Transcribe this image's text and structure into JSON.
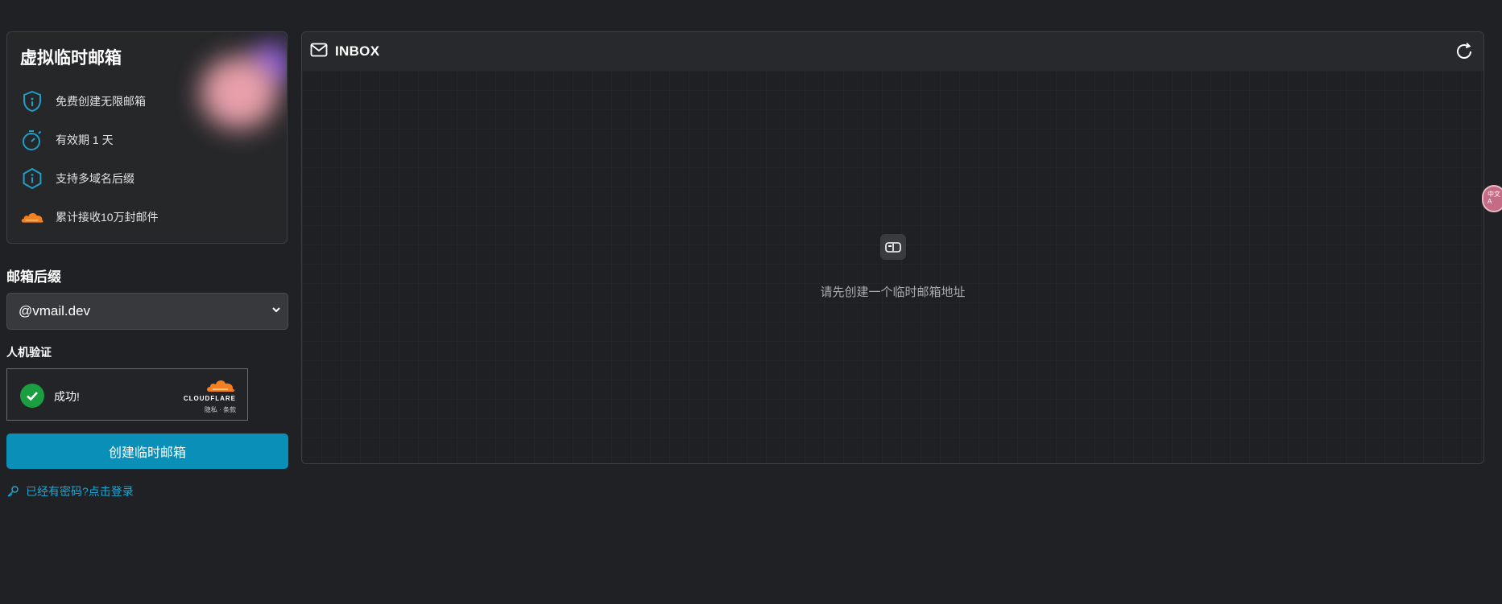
{
  "info_card": {
    "title": "虚拟临时邮箱",
    "features": [
      {
        "icon": "shield-icon",
        "text": "免费创建无限邮箱"
      },
      {
        "icon": "stopwatch-icon",
        "text": "有效期 1 天"
      },
      {
        "icon": "info-icon",
        "text": "支持多域名后缀"
      },
      {
        "icon": "cloudflare-icon",
        "text": "累计接收10万封邮件"
      }
    ]
  },
  "suffix": {
    "label": "邮箱后缀",
    "selected": "@vmail.dev"
  },
  "verification": {
    "label": "人机验证",
    "status": "成功!",
    "brand": "CLOUDFLARE",
    "links": "隐私 · 条款"
  },
  "create_button": "创建临时邮箱",
  "login_link": "已经有密码?点击登录",
  "inbox": {
    "title": "INBOX",
    "empty_message": "请先创建一个临时邮箱地址"
  },
  "extension_widget": {
    "line1": "中文",
    "line2": "A"
  },
  "colors": {
    "background": "#202125",
    "accent": "#0a90b8",
    "icon_teal": "#1f9ec9",
    "cloudflare_orange": "#f38020",
    "success_green": "#1a9e3f"
  }
}
